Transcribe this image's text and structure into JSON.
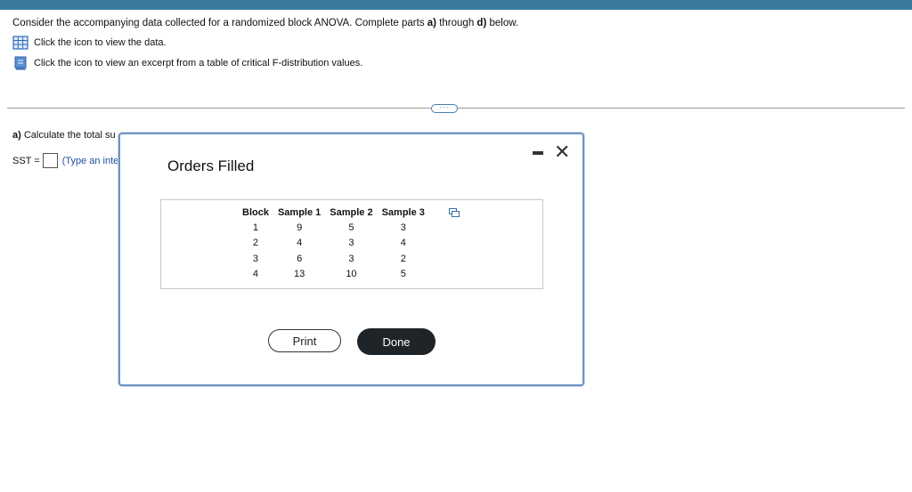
{
  "question": {
    "prefix": "Consider the accompanying data collected for a randomized block ANOVA. Complete parts ",
    "part_a": "a)",
    "middle": " through ",
    "part_d": "d)",
    "suffix": " below."
  },
  "links": {
    "data_link": "Click the icon to view the data.",
    "ftable_link": "Click the icon to view an excerpt from a table of critical F-distribution values."
  },
  "more_button": "···",
  "part_a": {
    "label": "a)",
    "text": " Calculate the total su",
    "sst_label": "SST =",
    "hint": "(Type an inte"
  },
  "dialog": {
    "title": "Orders Filled",
    "minimize": "minimize",
    "close_glyph": "✕",
    "table": {
      "headers": [
        "Block",
        "Sample 1",
        "Sample 2",
        "Sample 3"
      ],
      "rows": [
        [
          "1",
          "9",
          "5",
          "3"
        ],
        [
          "2",
          "4",
          "3",
          "4"
        ],
        [
          "3",
          "6",
          "3",
          "2"
        ],
        [
          "4",
          "13",
          "10",
          "5"
        ]
      ]
    },
    "print_label": "Print",
    "done_label": "Done"
  },
  "colors": {
    "topbar": "#3b7a9c",
    "link_text": "#1f4fa0",
    "done_button": "#1f2429",
    "dialog_border": "#6c94bf"
  },
  "icons": {
    "data_icon": "table-grid-icon",
    "ftable_icon": "book-icon",
    "copy_icon": "copy-icon"
  }
}
